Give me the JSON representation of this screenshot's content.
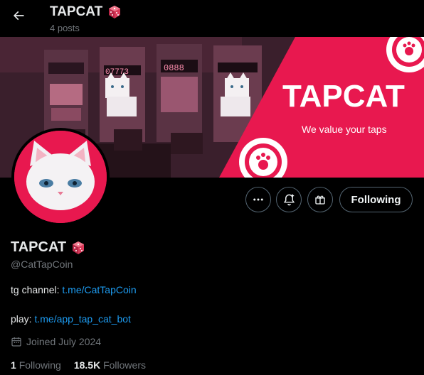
{
  "header": {
    "title": "TAPCAT",
    "posts_count": "4 posts"
  },
  "banner": {
    "brand_text": "TAPCAT",
    "tagline": "We value your taps",
    "slot_display_1": "07773",
    "slot_display_2": "0888"
  },
  "profile": {
    "display_name": "TAPCAT",
    "handle": "@CatTapCoin",
    "bio_label_1": "tg channel: ",
    "bio_link_1": "t.me/CatTapCoin",
    "bio_label_2": "play: ",
    "bio_link_2": "t.me/app_tap_cat_bot",
    "joined": "Joined July 2024"
  },
  "actions": {
    "following_label": "Following"
  },
  "stats": {
    "following_count": "1",
    "following_label": "Following",
    "followers_count": "18.5K",
    "followers_label": "Followers"
  },
  "colors": {
    "accent_pink": "#e8184f",
    "link_blue": "#1d9bf0",
    "muted": "#71767b"
  }
}
